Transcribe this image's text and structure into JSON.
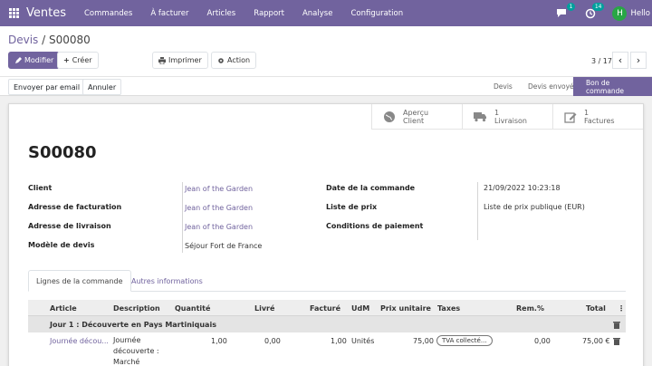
{
  "navbar": {
    "app_name": "Ventes",
    "menus": [
      "Commandes",
      "À facturer",
      "Articles",
      "Rapport",
      "Analyse",
      "Configuration"
    ],
    "messages_count": "1",
    "activities_count": "14",
    "user_initial": "H",
    "user_name": "Hello"
  },
  "breadcrumb": {
    "parent": "Devis",
    "separator": " / ",
    "current": "S00080"
  },
  "toolbar": {
    "edit": "Modifier",
    "create": "Créer",
    "print": "Imprimer",
    "action": "Action"
  },
  "pager": {
    "value": "3 / 17"
  },
  "statusbar": {
    "send_email": "Envoyer par email",
    "cancel": "Annuler",
    "stages": [
      "Devis",
      "Devis envoyé",
      "Bon de commande"
    ],
    "active_stage": "Bon de commande"
  },
  "smart_buttons": [
    {
      "line1": "Aperçu",
      "line2": "Client",
      "icon": "globe-icon"
    },
    {
      "line1": "1",
      "line2": "Livraison",
      "icon": "truck-icon"
    },
    {
      "line1": "1",
      "line2": "Factures",
      "icon": "edit-icon"
    }
  ],
  "record": {
    "name": "S00080",
    "client_label": "Client",
    "client": "Jean of the Garden",
    "invoice_addr_label": "Adresse de facturation",
    "invoice_addr": "Jean of the Garden",
    "delivery_addr_label": "Adresse de livraison",
    "delivery_addr": "Jean of the Garden",
    "template_label": "Modèle de devis",
    "template": "Séjour Fort de France",
    "date_label": "Date de la commande",
    "date": "21/09/2022 10:23:18",
    "pricelist_label": "Liste de prix",
    "pricelist": "Liste de prix publique (EUR)",
    "payment_terms_label": "Conditions de paiement",
    "payment_terms": ""
  },
  "tabs": [
    "Lignes de la commande",
    "Autres informations"
  ],
  "table": {
    "headers": [
      "Article",
      "Description",
      "Quantité",
      "Livré",
      "Facturé",
      "UdM",
      "Prix unitaire",
      "Taxes",
      "Rem.%",
      "Total"
    ],
    "section": "Jour 1  : Découverte en Pays Martiniquais",
    "row": {
      "article": "Journée décou...",
      "description_l1": "Journée",
      "description_l2": "découverte :",
      "description_l3": "Marché",
      "qty": "1,00",
      "delivered": "0,00",
      "invoiced": "1,00",
      "uom": "Unités",
      "unit_price": "75,00",
      "tax": "TVA collecté...",
      "discount": "0,00",
      "total": "75,00 €"
    }
  },
  "colors": {
    "brand": "#71639e",
    "badge": "#00a09d",
    "avatar": "#28a745"
  }
}
